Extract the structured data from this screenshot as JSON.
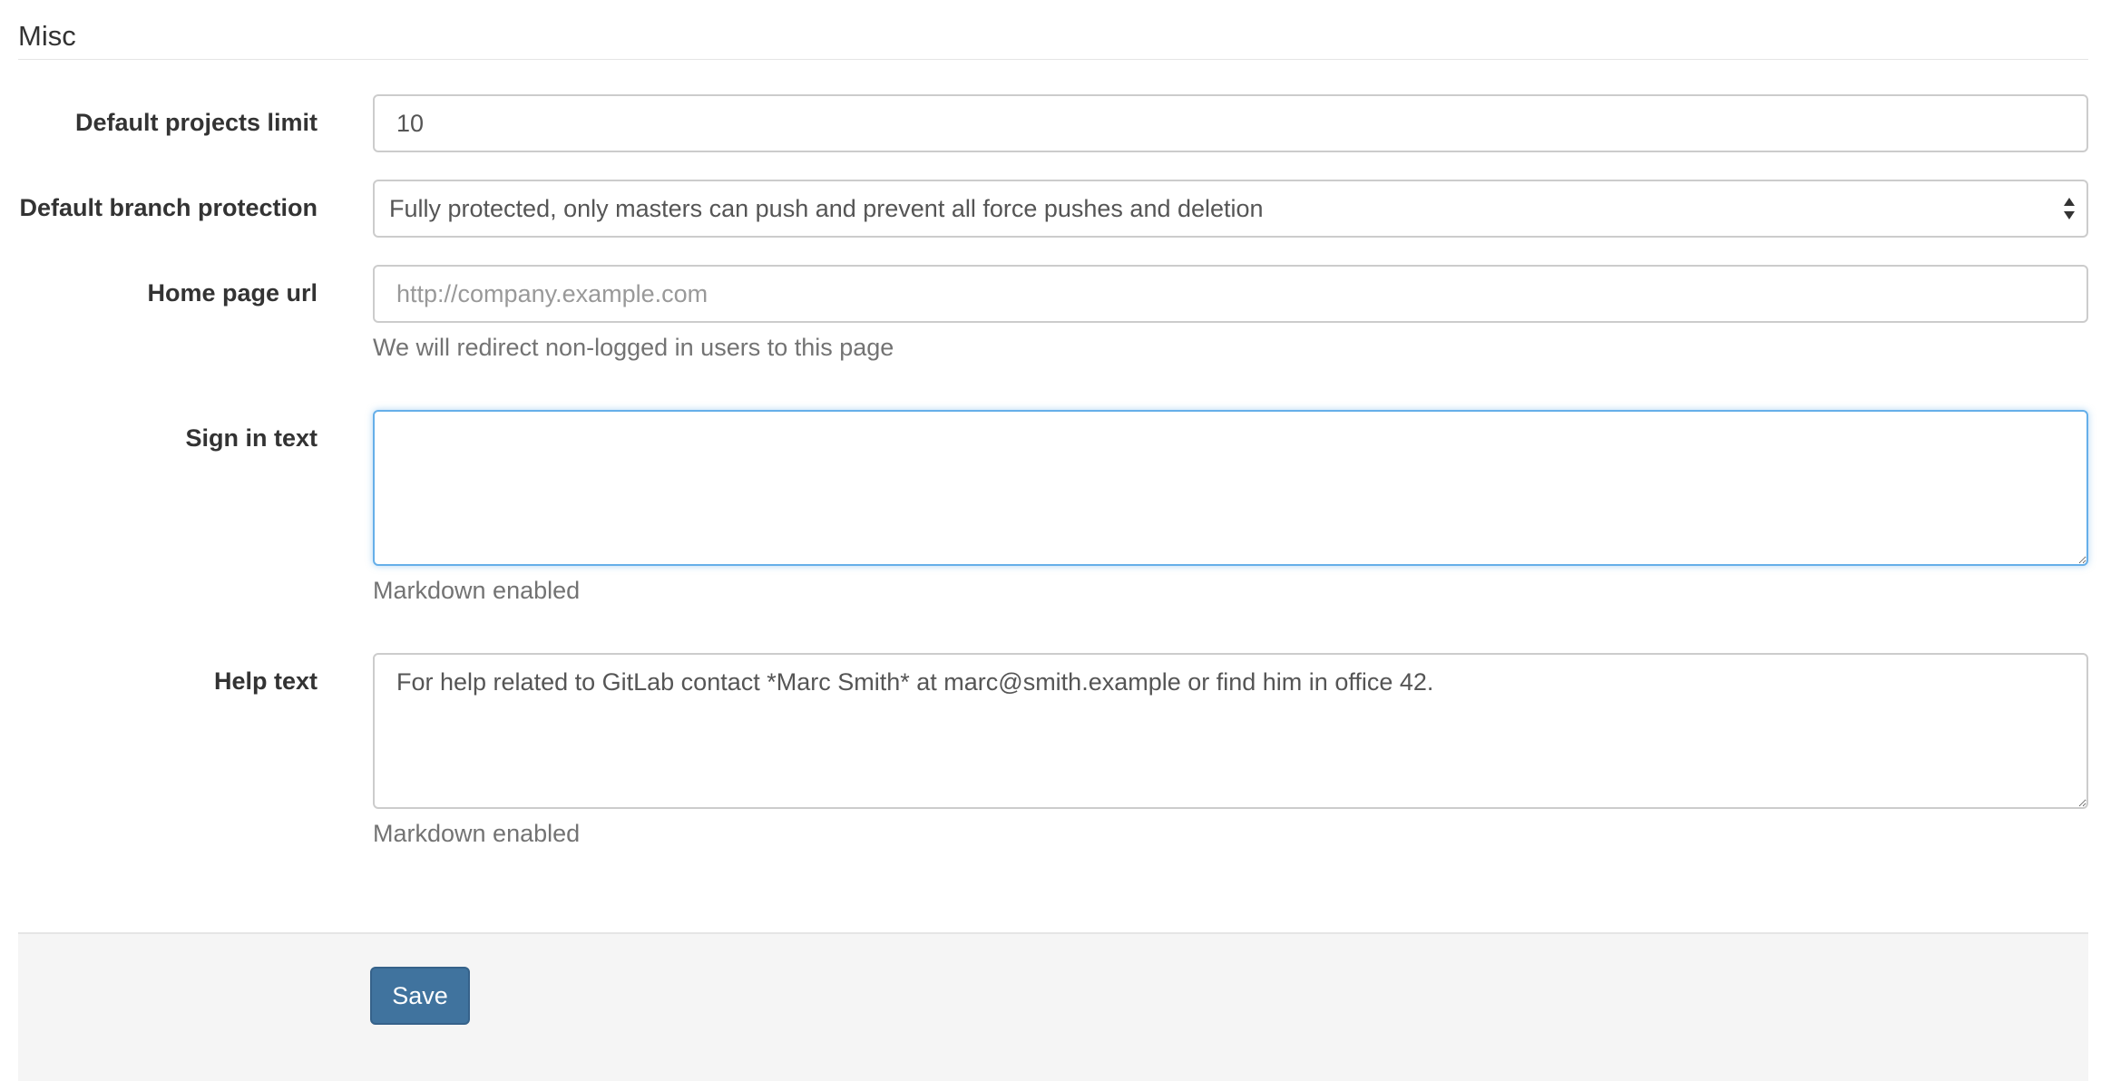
{
  "section": {
    "title": "Misc"
  },
  "fields": {
    "projects_limit": {
      "label": "Default projects limit",
      "value": "10"
    },
    "branch_protection": {
      "label": "Default branch protection",
      "selected": "Fully protected, only masters can push and prevent all force pushes and deletion"
    },
    "home_page_url": {
      "label": "Home page url",
      "value": "",
      "placeholder": "http://company.example.com",
      "help": "We will redirect non-logged in users to this page"
    },
    "sign_in_text": {
      "label": "Sign in text",
      "value": "",
      "help": "Markdown enabled"
    },
    "help_text": {
      "label": "Help text",
      "value": "For help related to GitLab contact *Marc Smith* at marc@smith.example or find him in office 42.",
      "help": "Markdown enabled"
    }
  },
  "actions": {
    "save_label": "Save"
  },
  "colors": {
    "primary_button": "#40739e",
    "focus_border": "#66afe9",
    "actions_background": "#f5f5f5"
  }
}
